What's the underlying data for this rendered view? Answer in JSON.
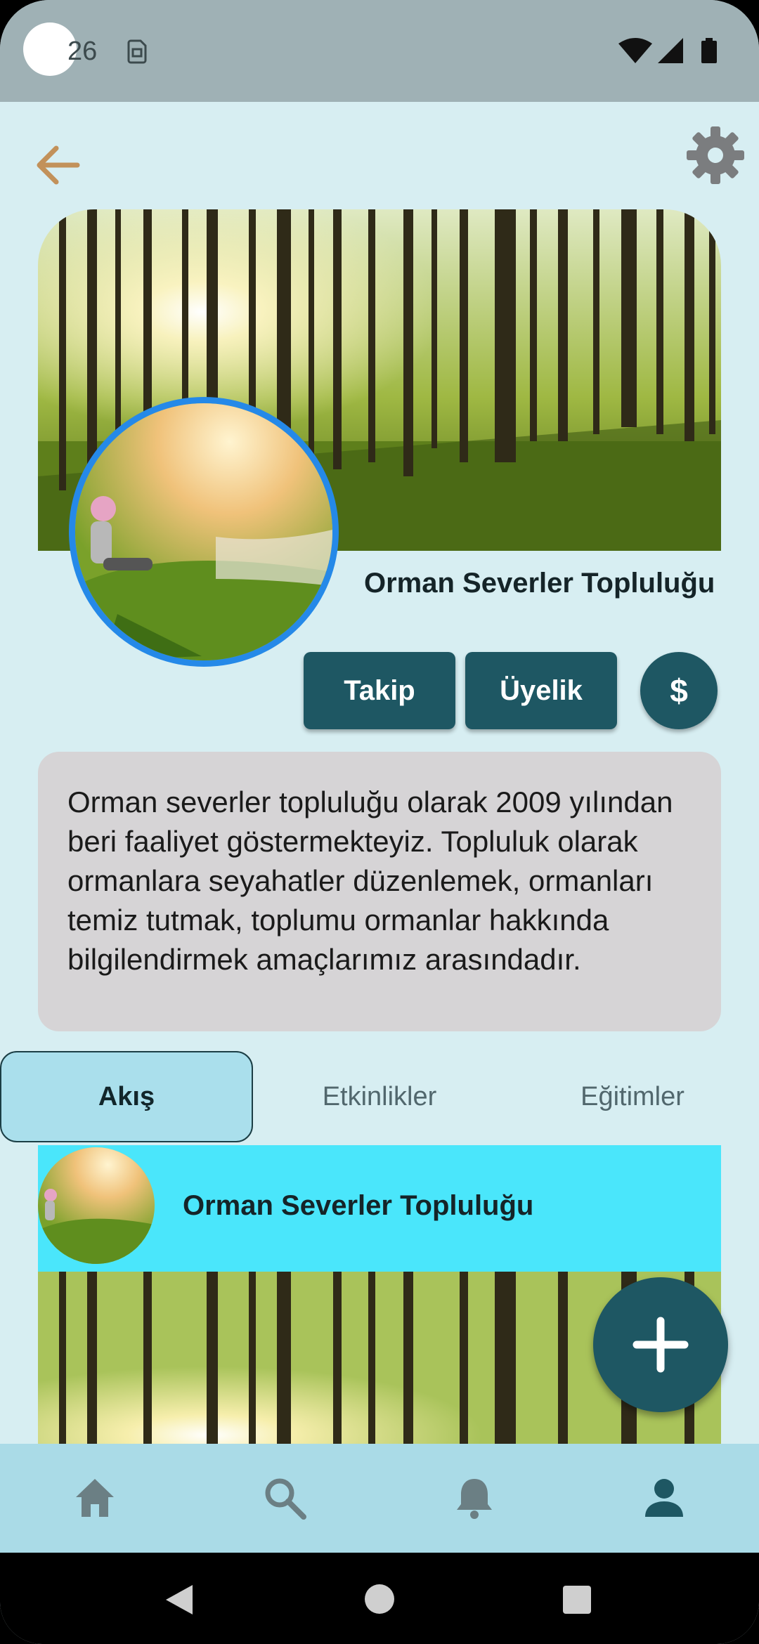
{
  "status_bar": {
    "time": "26",
    "icons": [
      "sim-card-icon",
      "wifi-icon",
      "signal-icon",
      "battery-icon"
    ]
  },
  "top_bar": {
    "back_icon": "arrow-left-icon",
    "settings_icon": "gear-icon"
  },
  "profile": {
    "name": "Orman Severler Topluluğu",
    "cover_image": "forest-sunlight-photo",
    "avatar_image": "hiker-in-forest-photo"
  },
  "actions": {
    "follow_label": "Takip",
    "membership_label": "Üyelik",
    "donate_label": "$"
  },
  "about": {
    "text": "Orman severler topluluğu olarak 2009 yılından beri faaliyet göstermekteyiz. Topluluk olarak ormanlara seyahatler düzenlemek, ormanları temiz tutmak, toplumu ormanlar hakkında bilgilendirmek amaçlarımız arasındadır."
  },
  "tabs": [
    {
      "label": "Akış",
      "active": true
    },
    {
      "label": "Etkinlikler",
      "active": false
    },
    {
      "label": "Eğitimler",
      "active": false
    }
  ],
  "post": {
    "author": "Orman Severler Topluluğu"
  },
  "fab": {
    "icon": "plus-icon"
  },
  "bottom_nav": [
    {
      "icon": "home-icon",
      "active": false
    },
    {
      "icon": "search-icon",
      "active": false
    },
    {
      "icon": "bell-icon",
      "active": false
    },
    {
      "icon": "person-icon",
      "active": true
    }
  ],
  "system_nav": [
    "back-triangle-icon",
    "home-circle-icon",
    "recents-square-icon"
  ],
  "colors": {
    "background": "#d7eef2",
    "primary": "#1e5763",
    "tab_active": "#aadfec",
    "post_header": "#4ae6fb",
    "bottom_nav": "#aadbe7",
    "avatar_ring": "#2589e8",
    "back_arrow": "#c2915a"
  }
}
